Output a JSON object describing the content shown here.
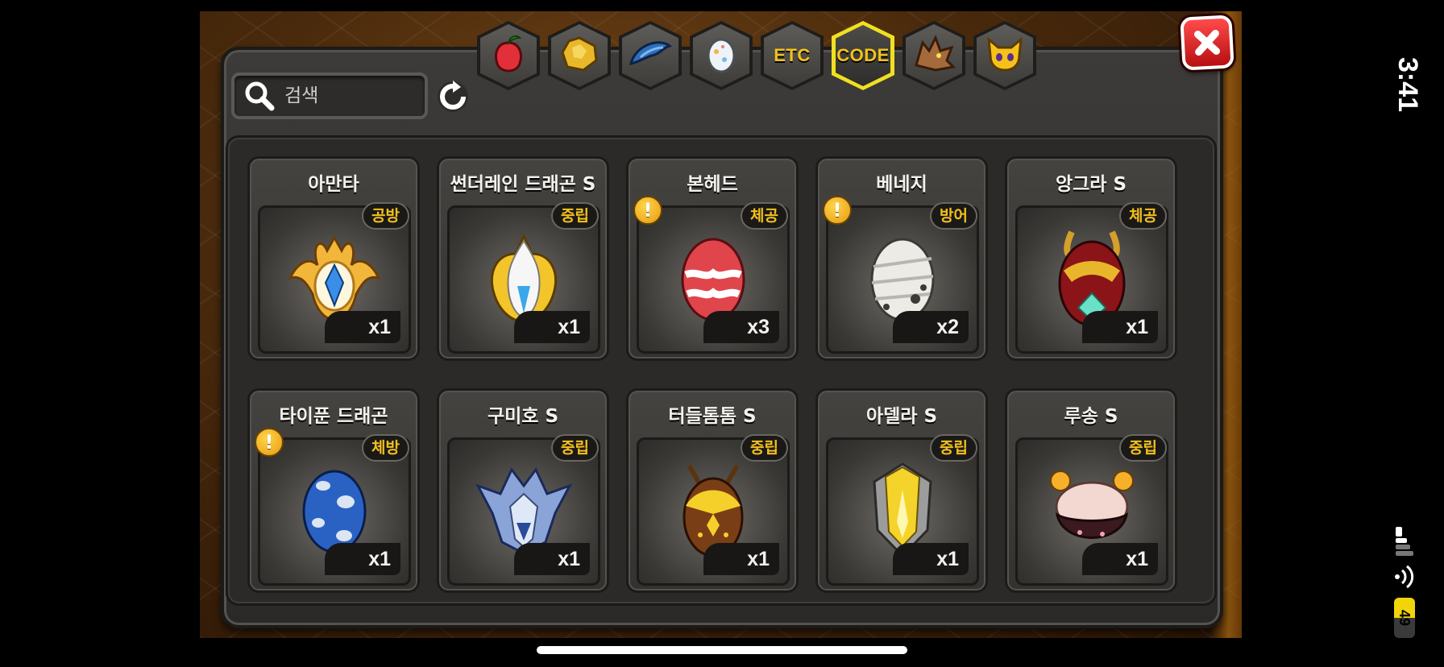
{
  "search": {
    "placeholder": "검색"
  },
  "tabs": [
    {
      "name": "fruit-tab",
      "icon": "red-fruit-icon",
      "label": "",
      "active": false
    },
    {
      "name": "gold-tab",
      "icon": "gold-nugget-icon",
      "label": "",
      "active": false
    },
    {
      "name": "material-tab",
      "icon": "blue-scale-icon",
      "label": "",
      "active": false
    },
    {
      "name": "egg-tab",
      "icon": "egg-icon",
      "label": "",
      "active": false
    },
    {
      "name": "etc-tab",
      "icon": "",
      "label": "ETC",
      "active": false
    },
    {
      "name": "code-tab",
      "icon": "",
      "label": "CODE",
      "active": true
    },
    {
      "name": "dragon-tab",
      "icon": "dragon-head-icon",
      "label": "",
      "active": false
    },
    {
      "name": "pet-tab",
      "icon": "yellow-pet-icon",
      "label": "",
      "active": false
    }
  ],
  "items": [
    {
      "name": "아만타",
      "attr": "공방",
      "count": "x1",
      "alert": false,
      "egg": "golden-winged"
    },
    {
      "name": "썬더레인 드래곤 S",
      "attr": "중립",
      "count": "x1",
      "alert": false,
      "egg": "white-gold-dragon"
    },
    {
      "name": "본헤드",
      "attr": "체공",
      "count": "x3",
      "alert": true,
      "egg": "red-bone"
    },
    {
      "name": "베네지",
      "attr": "방어",
      "count": "x2",
      "alert": true,
      "egg": "bandaged-white"
    },
    {
      "name": "앙그라 S",
      "attr": "체공",
      "count": "x1",
      "alert": false,
      "egg": "crimson-gold"
    },
    {
      "name": "타이푼 드래곤",
      "attr": "체방",
      "count": "x1",
      "alert": true,
      "egg": "blue-spotted"
    },
    {
      "name": "구미호 S",
      "attr": "중립",
      "count": "x1",
      "alert": false,
      "egg": "blue-fox"
    },
    {
      "name": "터들톰톰 S",
      "attr": "중립",
      "count": "x1",
      "alert": false,
      "egg": "brown-yellow"
    },
    {
      "name": "아델라 S",
      "attr": "중립",
      "count": "x1",
      "alert": false,
      "egg": "yellow-knight"
    },
    {
      "name": "루송 S",
      "attr": "중립",
      "count": "x1",
      "alert": false,
      "egg": "pink-chocolate"
    }
  ],
  "status": {
    "time": "3:41",
    "battery": "49",
    "battery_level": 0.49
  },
  "colors": {
    "accent": "#f3c01c",
    "close": "#d91a1d",
    "active_tab": "#f0e020"
  }
}
